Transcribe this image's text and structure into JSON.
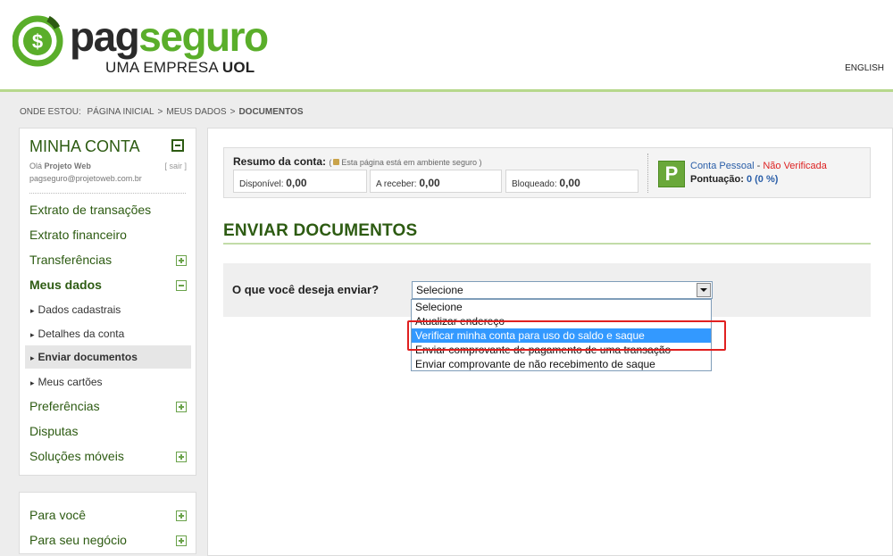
{
  "header": {
    "logo_pag": "pag",
    "logo_seguro": "seguro",
    "logo_sub_prefix": "UMA EMPRESA",
    "logo_sub_brand": "UOL",
    "language_link": "ENGLISH"
  },
  "breadcrumb": {
    "prefix": "ONDE ESTOU:",
    "items": [
      "PÁGINA INICIAL",
      "MEUS DADOS",
      "DOCUMENTOS"
    ],
    "separator": ">"
  },
  "sidebar": {
    "title": "MINHA CONTA",
    "greeting": "Olá",
    "user_name": "Projeto Web",
    "logout": "[ sair ]",
    "email": "pagseguro@projetoweb.com.br",
    "items": [
      {
        "label": "Extrato de transações"
      },
      {
        "label": "Extrato financeiro"
      },
      {
        "label": "Transferências"
      },
      {
        "label": "Meus dados"
      },
      {
        "label": "Dados cadastrais"
      },
      {
        "label": "Detalhes da conta"
      },
      {
        "label": "Enviar documentos"
      },
      {
        "label": "Meus cartões"
      },
      {
        "label": "Preferências"
      },
      {
        "label": "Disputas"
      },
      {
        "label": "Soluções móveis"
      }
    ],
    "secondary_items": [
      {
        "label": "Para você"
      },
      {
        "label": "Para seu negócio"
      }
    ]
  },
  "summary": {
    "title": "Resumo da conta:",
    "secure_note_open": "(",
    "secure_note": "Esta página está em ambiente seguro )",
    "disponivel_label": "Disponível:",
    "disponivel_value": "0,00",
    "receber_label": "A receber:",
    "receber_value": "0,00",
    "bloqueado_label": "Bloqueado:",
    "bloqueado_value": "0,00",
    "badge": "P",
    "account_type": "Conta Pessoal",
    "account_dash": " - ",
    "account_status": "Não Verificada",
    "score_label": "Pontuação:",
    "score_value": "0 (0 %)"
  },
  "main": {
    "title": "ENVIAR DOCUMENTOS",
    "question": "O que você deseja enviar?",
    "select_value": "Selecione",
    "options": [
      "Selecione",
      "Atualizar endereço",
      "Verificar minha conta para uso do saldo e saque",
      "Enviar comprovante de pagamento de uma transação",
      "Enviar comprovante de não recebimento de saque"
    ],
    "highlighted_option_index": 2
  },
  "colors": {
    "brand_green": "#5aae2a",
    "dark_green": "#2d5b12",
    "highlight_blue": "#3399ff",
    "annotation_red": "#e02020",
    "link_blue": "#2a5ea8"
  }
}
